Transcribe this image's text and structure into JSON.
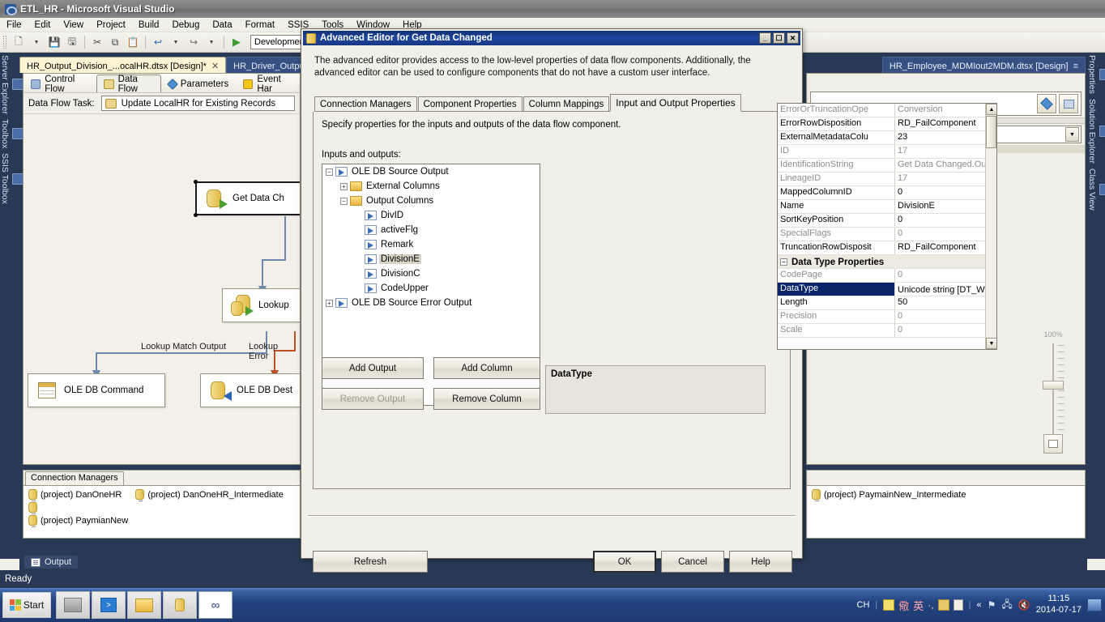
{
  "window": {
    "title": "ETL_HR - Microsoft Visual Studio",
    "menus": [
      "File",
      "Edit",
      "View",
      "Project",
      "Build",
      "Debug",
      "Data",
      "Format",
      "SSIS",
      "Tools",
      "Window",
      "Help"
    ],
    "toolbar": {
      "config_value": "Development"
    },
    "status_text": "Ready"
  },
  "dock_left": [
    "Server Explorer",
    "Toolbox",
    "SSIS Toolbox"
  ],
  "dock_right": [
    "Properties",
    "Solution Explorer",
    "Class View"
  ],
  "doc_tabs": [
    {
      "label": "HR_Output_Division_...ocalHR.dtsx [Design]*",
      "close": "✕"
    },
    {
      "label": "HR_Driver_OutputI",
      "close": "✕"
    }
  ],
  "right_doc_tab": {
    "label": "HR_Employee_MDMIout2MDM.dtsx [Design]",
    "menu_icon": "≡"
  },
  "designer": {
    "tabs": [
      {
        "label": "Control Flow",
        "icon": "control-flow-icon"
      },
      {
        "label": "Data Flow",
        "icon": "data-flow-icon"
      },
      {
        "label": "Parameters",
        "icon": "parameters-icon"
      },
      {
        "label": "Event Har",
        "icon": "event-handlers-icon"
      }
    ],
    "task_label": "Data Flow Task:",
    "task_value": "Update LocalHR for Existing Records",
    "nodes": [
      {
        "label": "Get Data Ch",
        "icon": "ole-db-source-icon"
      },
      {
        "label": "Lookup",
        "icon": "lookup-icon"
      },
      {
        "label": "OLE DB Command",
        "icon": "ole-db-command-icon"
      },
      {
        "label": "OLE DB Dest",
        "icon": "ole-db-destination-icon"
      }
    ],
    "connector_labels": [
      "Lookup Match Output",
      "Lookup Error"
    ],
    "zoom_label": "100%"
  },
  "connection_managers": {
    "tab_label": "Connection Managers",
    "items": [
      "(project) DanOneHR",
      "(project) DanOneHR_Intermediate",
      "(project) PaymianNew",
      "(project) PaymainNew_Intermediate"
    ]
  },
  "output_tab": {
    "label": "Output",
    "icon": "output-window-icon"
  },
  "dialog": {
    "title": "Advanced Editor for Get Data Changed",
    "title_icon": "editor-icon",
    "min_label": "_",
    "max_label": "☐",
    "close_label": "✕",
    "description": "The advanced editor provides access to the low-level properties of data flow components. Additionally, the advanced editor can be used to configure components that do not have a custom user interface.",
    "tabs": [
      "Connection Managers",
      "Component Properties",
      "Column Mappings",
      "Input and Output Properties"
    ],
    "selected_tab": "Input and Output Properties",
    "hint": "Specify properties for the inputs and outputs of the data flow component.",
    "io_label": "Inputs and outputs:",
    "tree": [
      {
        "label": "OLE DB Source Output",
        "depth": 0,
        "expander": "−",
        "icon": "output-icon"
      },
      {
        "label": "External Columns",
        "depth": 1,
        "expander": "+",
        "icon": "folder-icon"
      },
      {
        "label": "Output Columns",
        "depth": 1,
        "expander": "−",
        "icon": "folder-icon"
      },
      {
        "label": "DivID",
        "depth": 2,
        "expander": "",
        "icon": "column-icon"
      },
      {
        "label": "activeFlg",
        "depth": 2,
        "expander": "",
        "icon": "column-icon"
      },
      {
        "label": "Remark",
        "depth": 2,
        "expander": "",
        "icon": "column-icon"
      },
      {
        "label": "DivisionE",
        "depth": 2,
        "expander": "",
        "icon": "column-icon",
        "selected": true
      },
      {
        "label": "DivisionC",
        "depth": 2,
        "expander": "",
        "icon": "column-icon"
      },
      {
        "label": "CodeUpper",
        "depth": 2,
        "expander": "",
        "icon": "column-icon"
      },
      {
        "label": "OLE DB Source Error Output",
        "depth": 0,
        "expander": "+",
        "icon": "output-icon"
      }
    ],
    "properties": [
      {
        "name": "ErrorOrTruncationOpe",
        "value": "Conversion",
        "readonly": true
      },
      {
        "name": "ErrorRowDisposition",
        "value": "RD_FailComponent",
        "readonly": false
      },
      {
        "name": "ExternalMetadataColu",
        "value": "23",
        "readonly": false
      },
      {
        "name": "ID",
        "value": "17",
        "readonly": true
      },
      {
        "name": "IdentificationString",
        "value": "Get Data Changed.Output",
        "readonly": true
      },
      {
        "name": "LineageID",
        "value": "17",
        "readonly": true
      },
      {
        "name": "MappedColumnID",
        "value": "0",
        "readonly": false
      },
      {
        "name": "Name",
        "value": "DivisionE",
        "readonly": false
      },
      {
        "name": "SortKeyPosition",
        "value": "0",
        "readonly": false
      },
      {
        "name": "SpecialFlags",
        "value": "0",
        "readonly": true
      },
      {
        "name": "TruncationRowDisposit",
        "value": "RD_FailComponent",
        "readonly": false
      },
      {
        "name": "Data Type Properties",
        "value": "",
        "category": true,
        "expander": "−"
      },
      {
        "name": "CodePage",
        "value": "0",
        "readonly": true
      },
      {
        "name": "DataType",
        "value": "Unicode string [D",
        "value_tail": "T_WS",
        "selected": true,
        "editing": true
      },
      {
        "name": "Length",
        "value": "50",
        "readonly": false
      },
      {
        "name": "Precision",
        "value": "0",
        "readonly": true
      },
      {
        "name": "Scale",
        "value": "0",
        "readonly": true
      }
    ],
    "buttons": {
      "add_output": "Add Output",
      "add_column": "Add Column",
      "remove_output": "Remove Output",
      "remove_column": "Remove Column",
      "refresh": "Refresh",
      "ok": "OK",
      "cancel": "Cancel",
      "help": "Help"
    },
    "description_panel": {
      "title": "DataType",
      "body": ""
    }
  },
  "taskbar": {
    "start_label": "Start",
    "quick_items": [
      "server-manager-icon",
      "powershell-icon",
      "explorer-icon",
      "ssis-tools-icon",
      "visual-studio-icon"
    ],
    "tray": {
      "lang": "CH",
      "ime_icons": [
        "ime-pad-icon",
        "ime-mode-icon",
        "ime-english-icon",
        "ime-punct-icon",
        "ime-soft-keyboard-icon",
        "ime-help-icon"
      ],
      "show_hidden": "«",
      "icons": [
        "flag-icon",
        "network-icon",
        "volume-mute-icon"
      ],
      "time": "11:15",
      "date": "2014-07-17",
      "show_desktop": "show-desktop-icon"
    }
  }
}
